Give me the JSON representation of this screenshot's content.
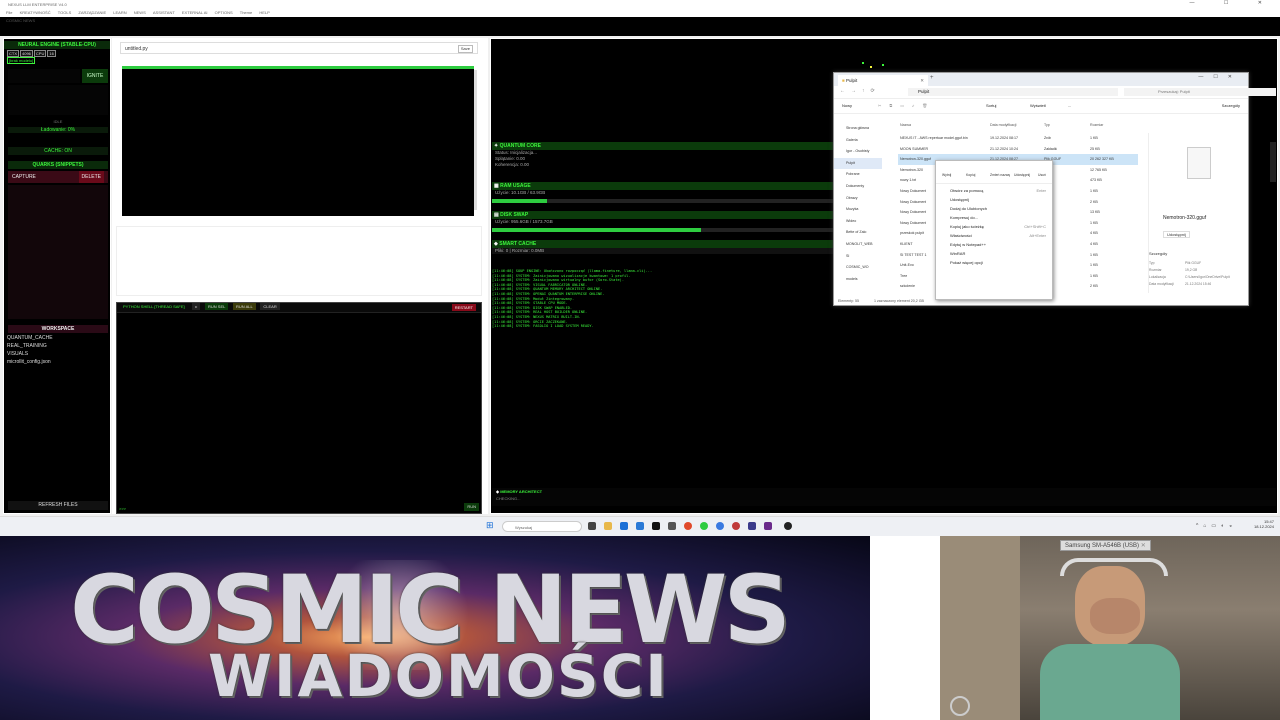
{
  "window": {
    "title": "NEXUS LLM ENTERPRISE V4.0",
    "menu": [
      "File",
      "KREATYWNOŚĆ",
      "TOOLS",
      "ZARZĄDZANIE",
      "LEARN",
      "NEWS",
      "ASSISTANT",
      "EXTERNAL AI",
      "OPTIONS",
      "Theme",
      "HELP"
    ],
    "controls": [
      "—",
      "☐",
      "✕"
    ],
    "subtitle": "COSMIC NEWS"
  },
  "left": {
    "engine_header": "NEURAL ENGINE (STABLE-CPU)",
    "chips": [
      "CTX",
      "4096",
      "CPU",
      "16"
    ],
    "model_tag": "[brak modelu]",
    "ignite": "IGNITE",
    "idle": "IDLE",
    "loading": "Ładowanie: 0%",
    "cache": "CACHE: ON",
    "quarks_header": "QUARKS (SNIPPETS)",
    "capture": "CAPTURE",
    "delete": "DELETE",
    "workspace_header": "WORKSPACE",
    "workspace_items": [
      "QUANTUM_CACHE",
      "REAL_TRAINING",
      "VISUALS",
      "microllit_config.json"
    ],
    "refresh": "REFRESH FILES"
  },
  "editor": {
    "filename": "untitled.py",
    "save": "Save"
  },
  "shell": {
    "title": "PYTHON SHELL [THREAD SAFE]",
    "buttons": [
      "RUN SEL",
      "RUN ALL",
      "CLEAR"
    ],
    "restart": "RESTART",
    "prompt": ">>>",
    "run": "RUN"
  },
  "stats": {
    "quantum_title": "QUANTUM CORE",
    "quantum_lines": [
      "Status: Inicjalizacja...",
      "Splątanie: 0.00",
      "Koherencja: 0.00"
    ],
    "ram_title": "RAM USAGE",
    "ram_line": "Użycie: 10.1GB / 63.9GB",
    "ram_pct": 0.16,
    "disk_title": "DISK SWAP",
    "disk_line": "Użycie: 955.6GB / 1573.7GB",
    "disk_pct": 0.61,
    "cache_title": "SMART CACHE",
    "cache_line": "Pliki: 0 | Rozmiar: 0.0MB",
    "arch_title": "MEMORY ARCHITECT",
    "arch_status": "CHECKING..."
  },
  "log": [
    "[11:46:08] SOUP ENGINE: Ukończono rozpocząć (llama-fineture, llama-cli)...",
    "[11:46:08] SYSTEM: Zainicjowano wizualizacje kwantowe: 1 profil.",
    "[11:46:08] SYSTEM: Zainicjowano wirtualny bufor (Soro-State).",
    "[11:46:08] SYSTEM: VISUAL FABRICATOR ONLINE.",
    "[11:46:08] SYSTEM: QUANTUM MEMORY ARCHITECT ONLINE.",
    "[11:46:08] SYSTEM: OPENAI QUANTUM ENTERPRISE ONLINE.",
    "[11:46:08] SYSTEM: Moduł Zintegrowany.",
    "[11:46:08] SYSTEM: STABLE CPU MODE.",
    "[11:46:08] SYSTEM: DISK SWAP ENABLED.",
    "[11:46:08] SYSTEM: REAL HOST BUILDER ONLINE.",
    "[11:46:08] SYSTEM: NEXUS MATRIX BUILT-IN.",
    "[11:46:08] SYSTEM: ORCIE ZACZEKANE.",
    "[11:46:08] SYSTEM: FASOLIO I LOAD SYSTEM READY."
  ],
  "explorer": {
    "tab": "Pulpit",
    "path": "Pulpit",
    "search_placeholder": "Przeszukaj: Pulpit",
    "toolbar": [
      "Nowy",
      "Sortuj",
      "Wyświetl",
      "..."
    ],
    "details": "Szczegóły",
    "nav": [
      "Strona główna",
      "Galeria",
      "Igor - Osobisty",
      "Pulpit",
      "Pobrane",
      "Dokumenty",
      "Obrazy",
      "Muzyka",
      "Wideo",
      "Bette of Zalo",
      "MONOLIT_WEB",
      "SI",
      "COSMIC_WO",
      "models"
    ],
    "columns": [
      "Nazwa",
      "Data modyfikacji",
      "Typ",
      "Rozmiar"
    ],
    "files": [
      {
        "name": "NEXUS IT - AWS repertuar model.gguf.bin",
        "date": "19.12.2024 08:17",
        "type": "Zrób",
        "size": "1 KB"
      },
      {
        "name": "MOON SUMMER",
        "date": "21.12.2024 10:24",
        "type": "Zakładki",
        "size": "25 KB"
      },
      {
        "name": "Nemotron-320.gguf",
        "date": "21.12.2024 08:27",
        "type": "Plik GGUF",
        "size": "20 262 327 KB"
      },
      {
        "name": "Nemotron-320",
        "date": "",
        "type": "",
        "size": "12 765 KB"
      },
      {
        "name": "nowy 1.txt",
        "date": "",
        "type": "",
        "size": "473 KB"
      },
      {
        "name": "Nowy Dokument",
        "date": "",
        "type": "",
        "size": "1 KB"
      },
      {
        "name": "Nowy Dokument",
        "date": "",
        "type": "",
        "size": "2 KB"
      },
      {
        "name": "Nowy Dokument",
        "date": "",
        "type": "",
        "size": "13 KB"
      },
      {
        "name": "Nowy Dokument",
        "date": "",
        "type": "",
        "size": "1 KB"
      },
      {
        "name": "przeskok pulpit",
        "date": "",
        "type": "",
        "size": "4 KB"
      },
      {
        "name": "KLIENT",
        "date": "",
        "type": "",
        "size": "4 KB"
      },
      {
        "name": "SI TEST TEST 1",
        "date": "",
        "type": "",
        "size": "1 KB"
      },
      {
        "name": "Unit-Evo",
        "date": "",
        "type": "",
        "size": "1 KB"
      },
      {
        "name": "Tree",
        "date": "",
        "type": "",
        "size": "1 KB"
      },
      {
        "name": "szkolenie",
        "date": "",
        "type": "",
        "size": "2 KB"
      }
    ],
    "status_left": "Elementy: 55",
    "status_mid": "1 zaznaczony element 20,2 GB",
    "preview_name": "Nemotron-320.gguf",
    "preview_sub": "Udostępnij",
    "props_title": "Szczegóły",
    "props": [
      "Typ",
      "Rozmiar",
      "Lokalizacja",
      "Data modyfikacji"
    ],
    "props_vals": [
      "Plik GGUF",
      "19,2 GB",
      "C:\\Users\\Igor\\OneDrive\\Pulpit",
      "21.12.2024 15:46"
    ]
  },
  "context_menu": {
    "top_actions": [
      "Wytnij",
      "Kopiuj",
      "Zmień nazwę",
      "Udostępnij",
      "Usuń"
    ],
    "items": [
      {
        "label": "Otwórz za pomocą",
        "shortcut": "Enter"
      },
      {
        "label": "Udostępnij",
        "shortcut": ""
      },
      {
        "label": "Dodaj do Ulubionych",
        "shortcut": ""
      },
      {
        "label": "Kompresuj do...",
        "shortcut": ""
      },
      {
        "label": "Kopiuj jako ścieżkę",
        "shortcut": "Ctrl+Shift+C"
      },
      {
        "label": "Właściwości",
        "shortcut": "Alt+Enter"
      },
      {
        "label": "Edytuj w Notepad++",
        "shortcut": ""
      },
      {
        "label": "WinRAR",
        "shortcut": ""
      },
      {
        "label": "Pokaż więcej opcji",
        "shortcut": ""
      }
    ]
  },
  "taskbar": {
    "search": "Wyszukaj",
    "time": "15:47",
    "date": "18.12.2024"
  },
  "banner": {
    "line1": "COSMIC NEWS",
    "line2": "WIADOMOŚCI"
  },
  "webcam": {
    "label": "Samsung SM-A546B (USB)"
  }
}
